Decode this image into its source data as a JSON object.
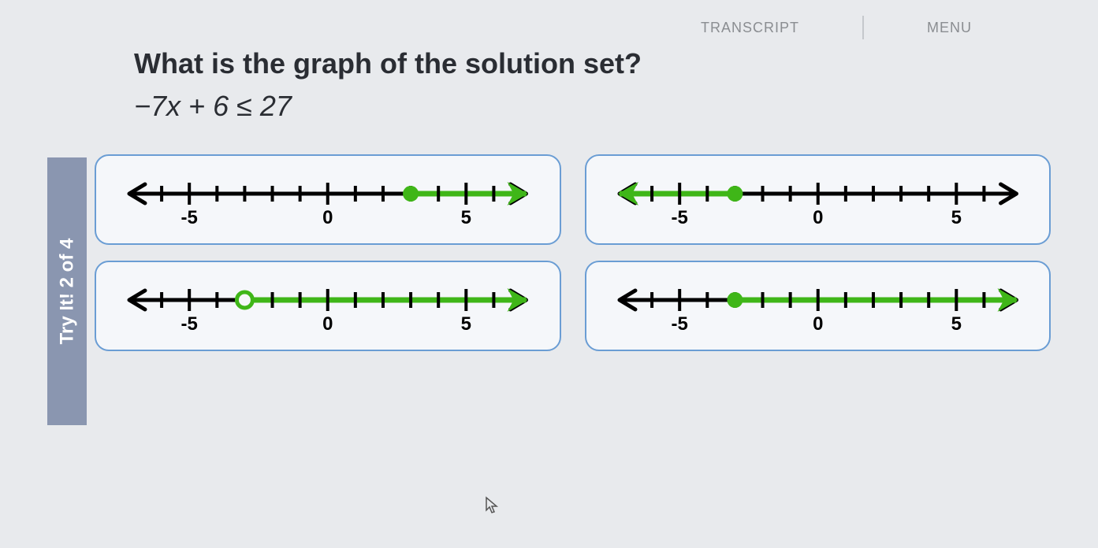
{
  "topbar": {
    "transcript_label": "TRANSCRIPT",
    "menu_label": "MENU"
  },
  "sidebar": {
    "label": "Try It! 2 of 4"
  },
  "question": {
    "title": "What is the graph of the solution set?",
    "inequality_raw": "-7x + 6 ≤ 27"
  },
  "chart_data": [
    {
      "type": "numberline",
      "xmin": -7,
      "xmax": 7,
      "ticks_major": [
        -5,
        0,
        5
      ],
      "point_value": 3,
      "point_style": "closed",
      "ray_direction": "right",
      "labels": [
        "-5",
        "0",
        "5"
      ]
    },
    {
      "type": "numberline",
      "xmin": -7,
      "xmax": 7,
      "ticks_major": [
        -5,
        0,
        5
      ],
      "point_value": -3,
      "point_style": "closed",
      "ray_direction": "left",
      "labels": [
        "-5",
        "0",
        "5"
      ]
    },
    {
      "type": "numberline",
      "xmin": -7,
      "xmax": 7,
      "ticks_major": [
        -5,
        0,
        5
      ],
      "point_value": -3,
      "point_style": "open",
      "ray_direction": "right",
      "labels": [
        "-5",
        "0",
        "5"
      ]
    },
    {
      "type": "numberline",
      "xmin": -7,
      "xmax": 7,
      "ticks_major": [
        -5,
        0,
        5
      ],
      "point_value": -3,
      "point_style": "closed",
      "ray_direction": "right",
      "labels": [
        "-5",
        "0",
        "5"
      ]
    }
  ]
}
